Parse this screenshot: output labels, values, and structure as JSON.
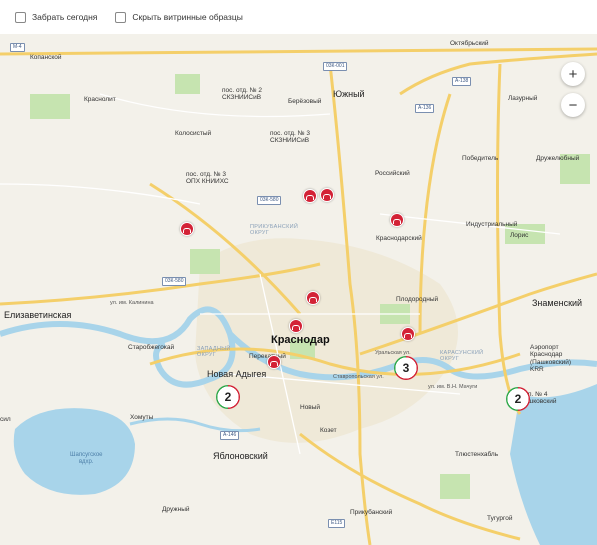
{
  "filters": [
    {
      "label": "Забрать сегодня",
      "checked": false
    },
    {
      "label": "Скрыть витринные образцы",
      "checked": false
    }
  ],
  "zoom": {
    "in": "+",
    "out": "−"
  },
  "labels": {
    "kopansky": "Копанской",
    "krasnolit": "Краснолит",
    "kolosisty": "Колосистый",
    "pos2": "пос. отд. № 2\nСКЗНИИСиВ",
    "pos3a": "пос. отд. № 3\nСКЗНИИСиВ",
    "pos3b": "пос. отд. № 3\nОПХ КНИИХС",
    "beryozovy": "Берёзовый",
    "yuzhny": "Южный",
    "oktyabrsky": "Октябрьский",
    "lazurny": "Лазурный",
    "russky": "Российский",
    "pobeditel": "Победитель",
    "druzhelyubny": "Дружелюбный",
    "industrialny": "Индустриальный",
    "loris": "Лорис",
    "krasnodarsky": "Краснодарский",
    "prikubansky": "ПРИКУБАНСКИЙ\nОКРУГ",
    "plodorodny": "Плодородный",
    "znamensky": "Знаменский",
    "elizavetinskaya": "Елизаветинская",
    "krasnodar": "Краснодар",
    "zapadny": "ЗАПАДНЫЙ\nОКРУГ",
    "karasunsky": "КАРАСУНСКИЙ\nОКРУГ",
    "starobzhegokai": "Старобжегокай",
    "perekatny": "Перекатный",
    "novaya_adygeya": "Новая Адыгея",
    "khomuty": "Хомуты",
    "novy": "Новый",
    "kozet": "Козет",
    "shapsugskoe": "Шапсугское\nвдхр.",
    "yablonovsky": "Яблоновский",
    "tlyustenkhabl": "Тлюстенхабль",
    "prikubansky2": "Прикубанский",
    "druzhny": "Дружный",
    "tugurgoy": "Тугургой",
    "airport": "Аэропорт\nКраснодар\n(Пашковский)\nKRR",
    "pos4": "п. № 4\nшковский",
    "ul_kalinina": "ул. им. Калинина",
    "ul_uralskaya": "Уральская ул.",
    "ul_stavropolskaya": "Ставропольская ул.",
    "ul_magurya": "ул. им. В.Н. Мачуги",
    "psil": "сил",
    "shield_m4": "М-4",
    "shield_03k001": "03К-001",
    "shield_a138": "А-138",
    "shield_a136": "А-136",
    "shield_03k580": "03К-580",
    "shield_03k580b": "03К-580",
    "shield_a146": "А-146",
    "shield_e115": "Е115"
  },
  "clusters": [
    {
      "count": "2",
      "red_fraction": 0.5
    },
    {
      "count": "3",
      "red_fraction": 0.67
    },
    {
      "count": "2",
      "red_fraction": 0.5
    }
  ],
  "colors": {
    "store": "#d32236",
    "cluster_red": "#d32236",
    "cluster_green": "#2ea84a",
    "water": "#a8d4ea",
    "park": "#c6e4b0",
    "road": "#f4cf6a"
  }
}
